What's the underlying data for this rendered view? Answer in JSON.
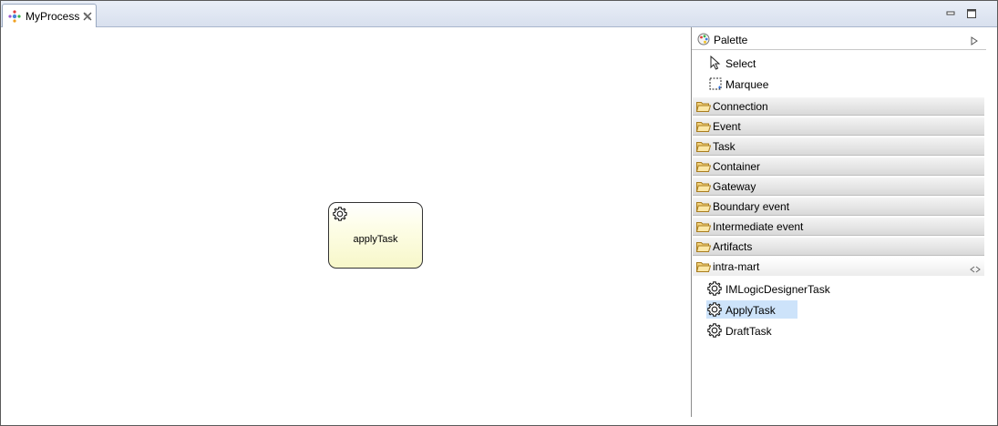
{
  "editor": {
    "tab_title": "MyProcess",
    "tab_icon": "process-icon",
    "minimize_icon": "minimize-icon",
    "maximize_icon": "maximize-icon"
  },
  "canvas": {
    "task": {
      "label": "applyTask",
      "icon": "gear-icon",
      "fill": "#fbfbd8",
      "border": "#333333"
    }
  },
  "palette": {
    "title": "Palette",
    "tools": [
      {
        "label": "Select",
        "icon": "arrow-pointer-icon"
      },
      {
        "label": "Marquee",
        "icon": "marquee-icon"
      }
    ],
    "drawers": [
      {
        "label": "Connection",
        "expanded": false
      },
      {
        "label": "Event",
        "expanded": false
      },
      {
        "label": "Task",
        "expanded": false
      },
      {
        "label": "Container",
        "expanded": false
      },
      {
        "label": "Gateway",
        "expanded": false
      },
      {
        "label": "Boundary event",
        "expanded": false
      },
      {
        "label": "Intermediate event",
        "expanded": false
      },
      {
        "label": "Artifacts",
        "expanded": false
      },
      {
        "label": "intra-mart",
        "expanded": true
      }
    ],
    "intra_mart_items": [
      {
        "label": "IMLogicDesignerTask",
        "icon": "gear-icon",
        "selected": false
      },
      {
        "label": "ApplyTask",
        "icon": "gear-icon",
        "selected": true
      },
      {
        "label": "DraftTask",
        "icon": "gear-icon",
        "selected": false
      }
    ],
    "selection_color": "#cde3fa"
  }
}
